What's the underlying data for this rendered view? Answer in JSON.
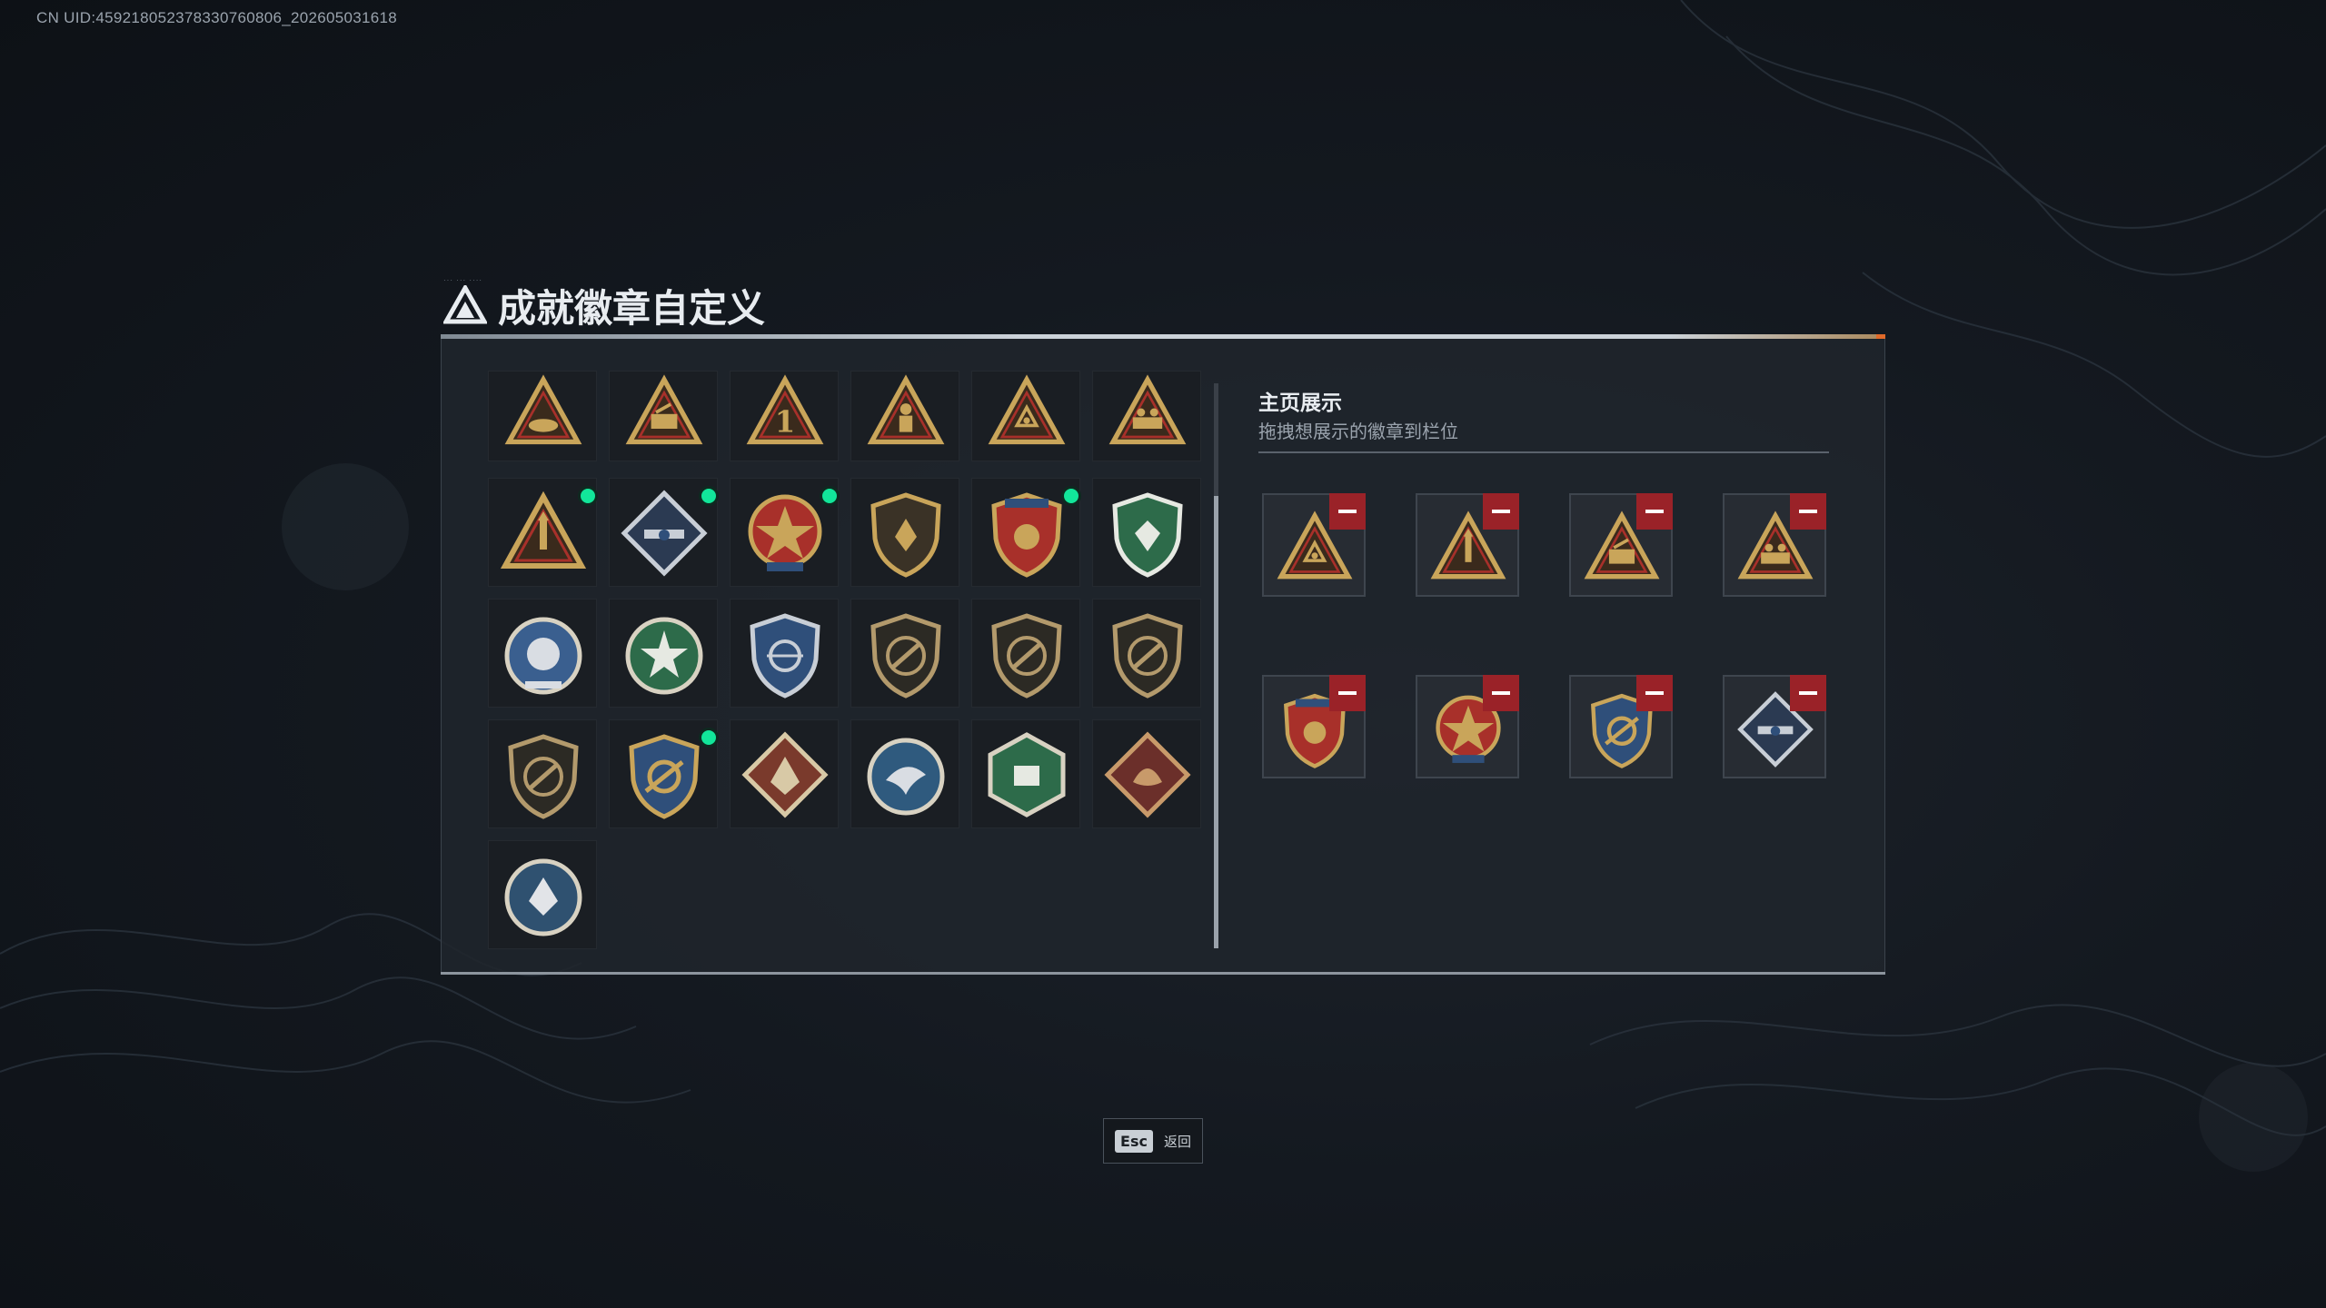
{
  "header": {
    "uid": "CN UID:459218052378330760806_202605031618"
  },
  "page": {
    "title": "成就徽章自定义",
    "title_tag": "··· ··· ····"
  },
  "showcase": {
    "title": "主页展示",
    "subtitle": "拖拽想展示的徽章到栏位"
  },
  "footer": {
    "esc_key": "Esc",
    "esc_label": "返回"
  },
  "colors": {
    "gold": "#c9a55a",
    "badge_dark": "#3a2a1c",
    "red": "#a8302a",
    "navy": "#2f4f7a",
    "green_badge": "#2d6b4a",
    "new_dot": "#12e69a",
    "remove_red": "#9a2228"
  },
  "badges": [
    {
      "icon": "triangle-bowl-badge",
      "new": false
    },
    {
      "icon": "triangle-soldiers-badge",
      "new": false
    },
    {
      "icon": "triangle-number-one-badge",
      "new": false
    },
    {
      "icon": "triangle-soldier-badge",
      "new": false
    },
    {
      "icon": "triangle-emblem-badge",
      "new": false
    },
    {
      "icon": "triangle-squad-badge",
      "new": false
    },
    {
      "icon": "triangle-rocket-badge",
      "new": true
    },
    {
      "icon": "diamond-launcher-badge",
      "new": true
    },
    {
      "icon": "star-medal-badge",
      "new": true
    },
    {
      "icon": "shield-wings-badge",
      "new": false
    },
    {
      "icon": "crest-stars-badge",
      "new": true
    },
    {
      "icon": "green-crest-badge",
      "new": false
    },
    {
      "icon": "blue-lion-badge",
      "new": false
    },
    {
      "icon": "green-burst-badge",
      "new": false
    },
    {
      "icon": "blue-crosshair-badge",
      "new": false
    },
    {
      "icon": "bronze-shield-rifle-badge",
      "new": false
    },
    {
      "icon": "bronze-shield-knife-badge",
      "new": false
    },
    {
      "icon": "bronze-shield-smg-badge",
      "new": false
    },
    {
      "icon": "bronze-shield-sniper-badge",
      "new": false
    },
    {
      "icon": "gold-shield-crosshair-badge",
      "new": true
    },
    {
      "icon": "diamond-wolf-badge",
      "new": false
    },
    {
      "icon": "round-eagle-badge",
      "new": false
    },
    {
      "icon": "hex-engineer-badge",
      "new": false
    },
    {
      "icon": "diamond-dragon-badge",
      "new": false
    },
    {
      "icon": "round-wolf-badge",
      "new": false
    }
  ],
  "showcase_slots": [
    {
      "icon": "triangle-emblem-badge"
    },
    {
      "icon": "triangle-rocket-badge"
    },
    {
      "icon": "triangle-soldiers-badge"
    },
    {
      "icon": "triangle-squad-badge"
    },
    {
      "icon": "crest-stars-badge"
    },
    {
      "icon": "star-medal-badge"
    },
    {
      "icon": "gold-shield-crosshair-badge"
    },
    {
      "icon": "diamond-launcher-badge"
    }
  ]
}
